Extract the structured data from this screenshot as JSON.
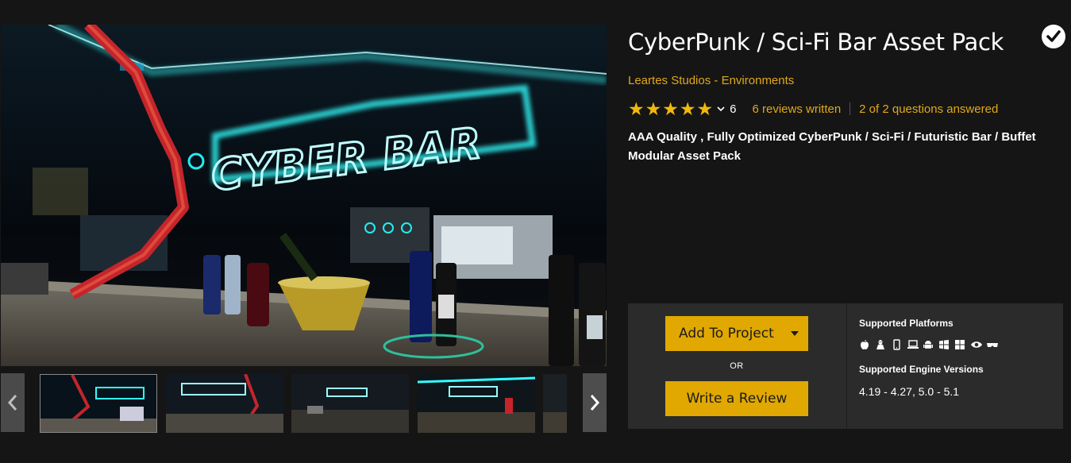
{
  "product": {
    "title": "CyberPunk / Sci-Fi Bar Asset Pack",
    "seller": "Leartes Studios",
    "byline_separator": "-",
    "category": "Environments",
    "rating": 5,
    "rating_count": "6",
    "reviews_link": "6 reviews written",
    "questions_link": "2 of 2 questions answered",
    "description": "AAA Quality , Fully Optimized CyberPunk / Sci-Fi / Futuristic Bar / Buffet Modular Asset Pack",
    "owned_icon": "check-circle-icon"
  },
  "gallery": {
    "hero_sign_text": "CYBER BAR",
    "thumb_count": 5
  },
  "purchase": {
    "add_button": "Add To Project",
    "or_label": "OR",
    "review_button": "Write a Review",
    "platforms_heading": "Supported Platforms",
    "platform_icons": [
      "apple-icon",
      "linux-icon",
      "mobile-icon",
      "laptop-icon",
      "android-icon",
      "windows-icon",
      "windows-store-icon",
      "vr-eye-icon",
      "headset-icon"
    ],
    "engine_heading": "Supported Engine Versions",
    "engine_versions": "4.19 - 4.27, 5.0 - 5.1"
  },
  "colors": {
    "accent": "#e0a800",
    "link": "#e2a81a",
    "star": "#f2b80d",
    "panel": "#2b2b2b",
    "background": "#151515"
  }
}
